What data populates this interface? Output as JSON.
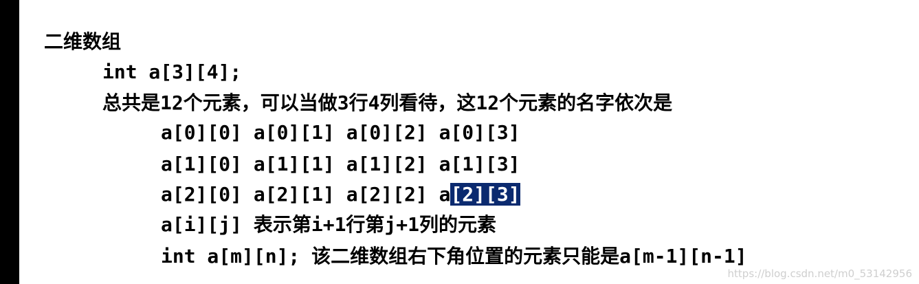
{
  "heading": "二维数组",
  "declaration": "int a[3][4];",
  "description": "总共是12个元素，可以当做3行4列看待，这12个元素的名字依次是",
  "rows": [
    "a[0][0] a[0][1] a[0][2] a[0][3]",
    "a[1][0] a[1][1] a[1][2] a[1][3]"
  ],
  "row2_plain": "a[2][0] a[2][1] a[2][2] a",
  "row2_selected": "[2][3]",
  "element_meaning": "a[i][j] 表示第i+1行第j+1列的元素",
  "general_rule": "int a[m][n]; 该二维数组右下角位置的元素只能是a[m-1][n-1]",
  "watermark": "https://blog.csdn.net/m0_53142956",
  "colors": {
    "selection_background": "#0b2a6f",
    "selection_text": "#ffffff",
    "left_border": "#000000"
  }
}
